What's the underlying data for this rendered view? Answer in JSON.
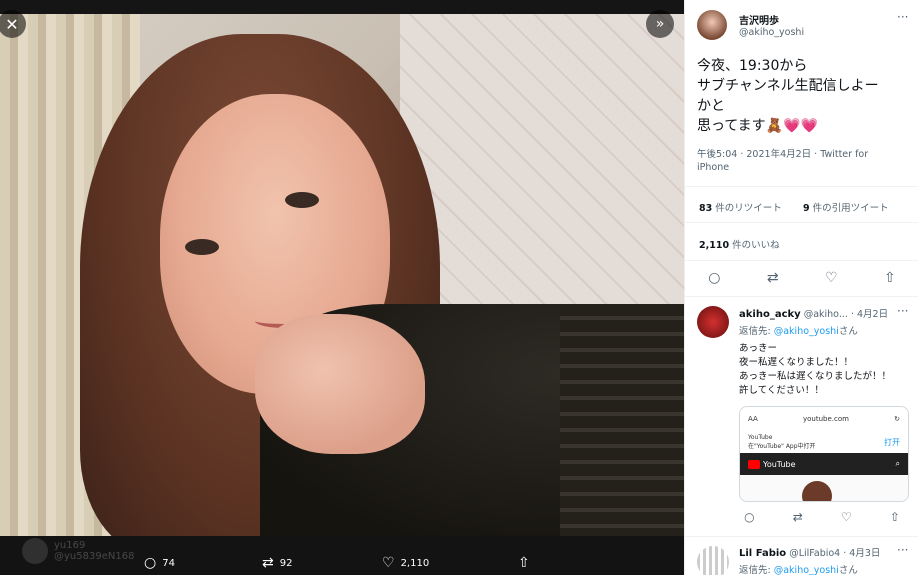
{
  "viewer": {
    "ghost_user": "yu169",
    "ghost_handle": "@yu5839eN168",
    "reply_count": "74",
    "retweet_count": "92",
    "like_count": "2,110"
  },
  "tweet": {
    "name": "吉沢明歩",
    "handle": "@akiho_yoshi",
    "lines": [
      "今夜、19:30から",
      "サブチャンネル生配信しよー",
      "かと",
      "思ってます🧸💗💗"
    ],
    "time": "午後5:04 · 2021年4月2日 · Twitter for iPhone",
    "retweets_num": "83",
    "retweets_label": "件のリツイート",
    "quotes_num": "9",
    "quotes_label": "件の引用ツイート",
    "likes_num": "2,110",
    "likes_label": "件のいいね"
  },
  "reply1": {
    "name": "akiho_acky",
    "handle": "@akiho...",
    "date": "· 4月2日",
    "reply_to_prefix": "返信先: ",
    "reply_to_handle": "@akiho_yoshi",
    "reply_to_suffix": "さん",
    "lines": [
      "あっきー",
      "夜ー私遅くなりました！！",
      "あっきー私は遅くなりましたが！！",
      "許してください！！"
    ],
    "card": {
      "aa": "AA",
      "url": "youtube.com",
      "app_title": "YouTube",
      "app_sub": "在\"YouTube\" App中打开",
      "open_label": "打开",
      "brand": "YouTube"
    }
  },
  "reply2": {
    "name": "Lil Fabio",
    "handle": "@LilFabio4",
    "date": "· 4月3日",
    "reply_to_prefix": "返信先: ",
    "reply_to_handle": "@akiho_yoshi",
    "reply_to_suffix": "さん"
  }
}
